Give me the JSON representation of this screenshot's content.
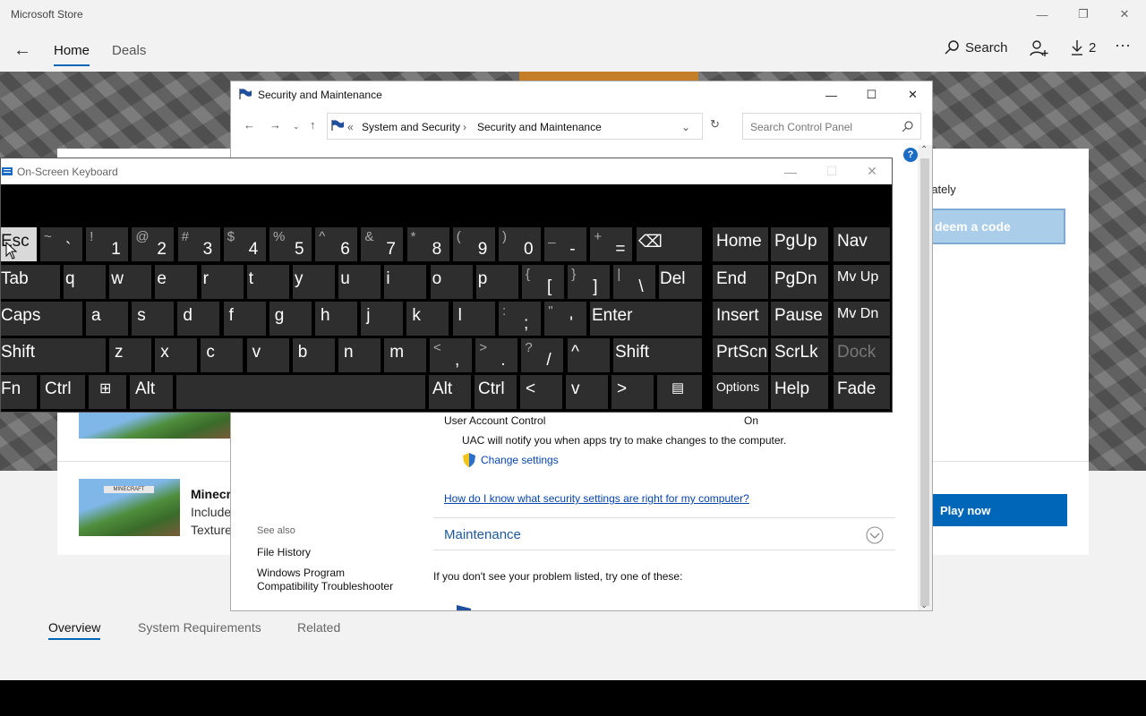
{
  "store": {
    "title": "Microsoft Store",
    "nav": {
      "back": "←",
      "tabs": [
        {
          "label": "Home",
          "active": true
        },
        {
          "label": "Deals",
          "active": false
        }
      ],
      "search": "Search",
      "downloads": "2",
      "more": "···"
    },
    "hero_partial_text": "rately",
    "redeem_button": "deem a code",
    "play_button": "Play now",
    "product": {
      "name": "Minecr",
      "line1": "Include",
      "line2": "Texture"
    },
    "product_tabs": [
      {
        "label": "Overview",
        "active": true
      },
      {
        "label": "System Requirements"
      },
      {
        "label": "Related"
      }
    ]
  },
  "security": {
    "title": "Security and Maintenance",
    "breadcrumb": {
      "prefix": "«",
      "items": [
        "System and Security",
        "Security and Maintenance"
      ]
    },
    "search_placeholder": "Search Control Panel",
    "uac_label": "User Account Control",
    "uac_state": "On",
    "uac_desc": "UAC will notify you when apps try to make changes to the computer.",
    "change_settings": "Change settings",
    "help_link": "How do I know what security settings are right for my computer?",
    "maintenance": "Maintenance",
    "see_also_title": "See also",
    "see_also": [
      "File History",
      "Windows Program",
      "Compatibility Troubleshooter"
    ],
    "problem_text": "If you don't see your problem listed, try one of these:",
    "help_icon": "?"
  },
  "osk": {
    "title": "On-Screen Keyboard",
    "rows": {
      "esc": "Esc",
      "number_row": [
        {
          "s": "~",
          "m": "`"
        },
        {
          "s": "!",
          "m": "1"
        },
        {
          "s": "@",
          "m": "2"
        },
        {
          "s": "#",
          "m": "3"
        },
        {
          "s": "$",
          "m": "4"
        },
        {
          "s": "%",
          "m": "5"
        },
        {
          "s": "^",
          "m": "6"
        },
        {
          "s": "&",
          "m": "7"
        },
        {
          "s": "*",
          "m": "8"
        },
        {
          "s": "(",
          "m": "9"
        },
        {
          "s": ")",
          "m": "0"
        },
        {
          "s": "_",
          "m": "-"
        },
        {
          "s": "+",
          "m": "="
        }
      ],
      "backspace": "⌫",
      "tab": "Tab",
      "q_row": [
        "q",
        "w",
        "e",
        "r",
        "t",
        "y",
        "u",
        "i",
        "o",
        "p"
      ],
      "q_row_sym": [
        {
          "s": "{",
          "m": "["
        },
        {
          "s": "}",
          "m": "]"
        },
        {
          "s": "|",
          "m": "\\"
        }
      ],
      "del": "Del",
      "caps": "Caps",
      "a_row": [
        "a",
        "s",
        "d",
        "f",
        "g",
        "h",
        "j",
        "k",
        "l"
      ],
      "a_row_sym": [
        {
          "s": ":",
          "m": ";"
        },
        {
          "s": "\"",
          "m": "'"
        }
      ],
      "enter": "Enter",
      "shift": "Shift",
      "z_row": [
        "z",
        "x",
        "c",
        "v",
        "b",
        "n",
        "m"
      ],
      "z_row_sym": [
        {
          "s": "<",
          "m": ","
        },
        {
          "s": ">",
          "m": "."
        },
        {
          "s": "?",
          "m": "/"
        }
      ],
      "up": "^",
      "fn": "Fn",
      "ctrl": "Ctrl",
      "alt": "Alt",
      "left": "<",
      "down": "v",
      "right": ">",
      "menu": "▤"
    },
    "nav_keys": [
      "Home",
      "PgUp",
      "Nav",
      "End",
      "PgDn",
      "Mv Up",
      "Insert",
      "Pause",
      "Mv Dn",
      "PrtScn",
      "ScrLk",
      "Dock",
      "Options",
      "Help",
      "Fade"
    ]
  }
}
